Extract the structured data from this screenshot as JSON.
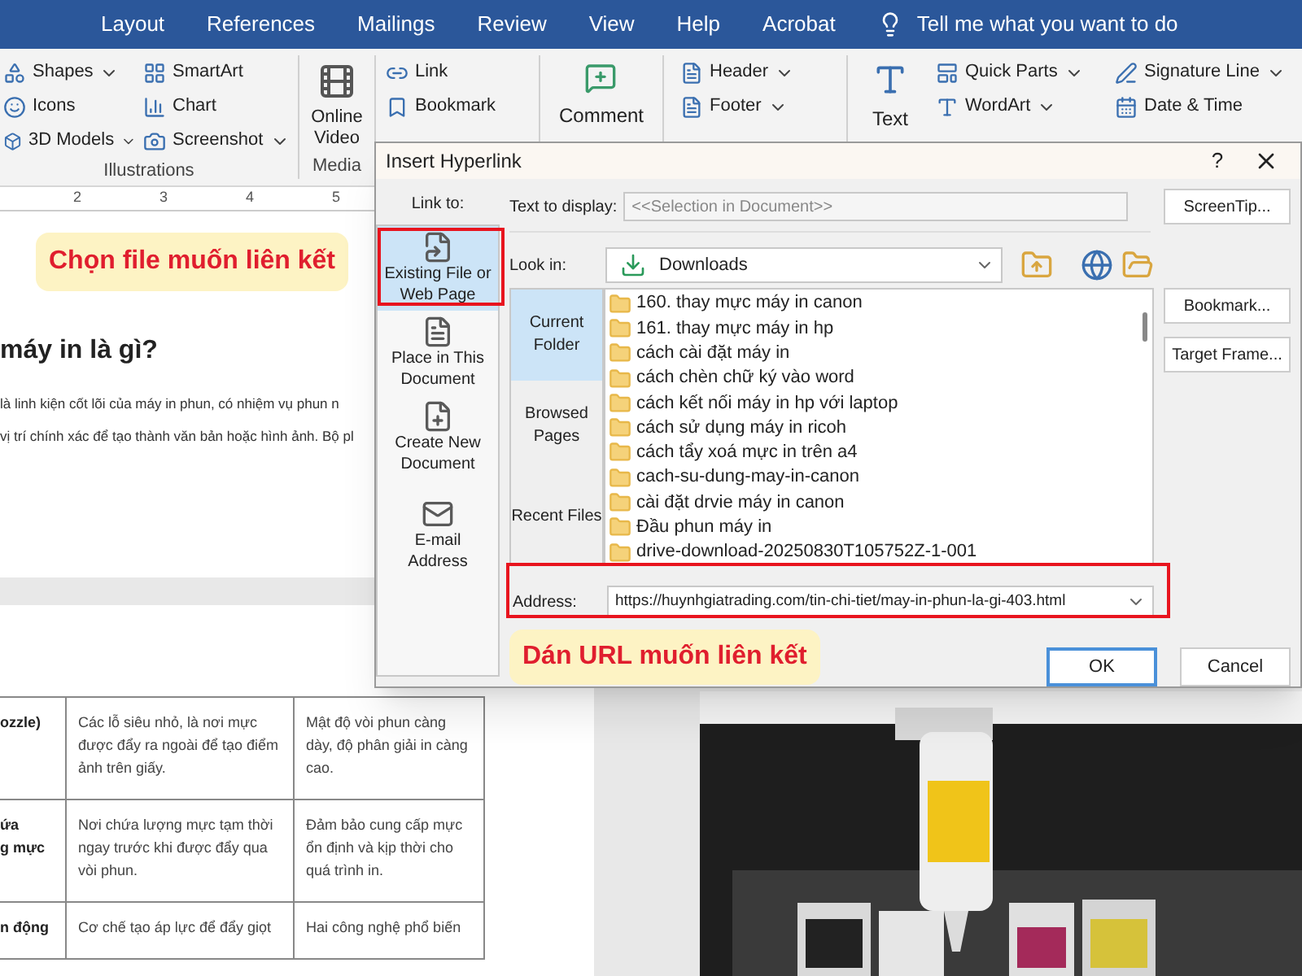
{
  "menu_tabs": [
    "Layout",
    "References",
    "Mailings",
    "Review",
    "View",
    "Help",
    "Acrobat"
  ],
  "tell_me": "Tell me what you want to do",
  "ribbon": {
    "illustrations": {
      "col1": [
        {
          "label": "Shapes",
          "dropdown": true
        },
        {
          "label": "Icons",
          "dropdown": false
        },
        {
          "label": "3D Models",
          "dropdown": true
        }
      ],
      "col2": [
        {
          "label": "SmartArt",
          "dropdown": false
        },
        {
          "label": "Chart",
          "dropdown": false
        },
        {
          "label": "Screenshot",
          "dropdown": true
        }
      ],
      "group_label": "Illustrations"
    },
    "media": {
      "button": "Online Video",
      "group_label": "Media"
    },
    "links": [
      {
        "label": "Link"
      },
      {
        "label": "Bookmark"
      }
    ],
    "comment": "Comment",
    "header_footer": [
      {
        "label": "Header"
      },
      {
        "label": "Footer"
      }
    ],
    "text": {
      "button": "Text",
      "col1": [
        {
          "label": "Quick Parts"
        },
        {
          "label": "WordArt"
        }
      ],
      "col2": [
        {
          "label": "Signature Line",
          "dropdown": true
        },
        {
          "label": "Date & Time",
          "dropdown": false
        }
      ]
    }
  },
  "ruler": [
    "2",
    "3",
    "4",
    "5"
  ],
  "document": {
    "heading": "máy in là gì?",
    "paragraphs": [
      "là linh kiện cốt lõi của máy in phun, có nhiệm vụ phun n",
      "vị trí chính xác để tạo thành văn bản hoặc hình ảnh. Bộ pl"
    ],
    "table": {
      "rows": [
        [
          "ozzle)",
          "Các lỗ siêu nhỏ, là nơi mực được đẩy ra ngoài để tạo điểm ảnh trên giấy.",
          "Mật độ vòi phun càng dày, độ phân giải in càng cao."
        ],
        [
          "ứa\ng mực",
          "Nơi chứa lượng mực tạm thời ngay trước khi được đẩy qua vòi phun.",
          "Đảm bảo cung cấp mực ổn định và kịp thời cho quá trình in."
        ],
        [
          "n động",
          "Cơ chế tạo áp lực để đẩy giọt",
          "Hai công nghệ phổ biến"
        ]
      ]
    }
  },
  "callouts": [
    "Chọn file muốn liên kết",
    "Dán URL muốn liên kết"
  ],
  "dialog": {
    "title": "Insert Hyperlink",
    "help": "?",
    "link_to_label": "Link to:",
    "link_to": [
      {
        "label": "Existing File or Web Page",
        "kind": "file",
        "selected": true
      },
      {
        "label": "Place in This Document",
        "kind": "place",
        "selected": false
      },
      {
        "label": "Create New Document",
        "kind": "new",
        "selected": false
      },
      {
        "label": "E-mail Address",
        "kind": "mail",
        "selected": false
      }
    ],
    "text_to_display": {
      "label": "Text to display:",
      "placeholder": "<<Selection in Document>>"
    },
    "look_in": {
      "label": "Look in:",
      "value": "Downloads"
    },
    "nav": [
      {
        "label": "Current Folder",
        "selected": true
      },
      {
        "label": "Browsed Pages",
        "selected": false
      },
      {
        "label": "Recent Files",
        "selected": false
      }
    ],
    "files": [
      "160. thay mực máy in canon",
      "161. thay mực máy in hp",
      "cách cài đặt máy in",
      "cách chèn chữ ký vào word",
      "cách kết nối máy in hp với laptop",
      "cách sử dụng máy in ricoh",
      "cách tẩy xoá mực in trên a4",
      "cach-su-dung-may-in-canon",
      "cài đặt drvie máy in canon",
      "Đầu phun máy in",
      "drive-download-20250830T105752Z-1-001"
    ],
    "address": {
      "label": "Address:",
      "value": "https://huynhgiatrading.com/tin-chi-tiet/may-in-phun-la-gi-403.html"
    },
    "side_buttons": [
      "ScreenTip...",
      "Bookmark...",
      "Target Frame..."
    ],
    "buttons": [
      {
        "label": "OK",
        "default": true
      },
      {
        "label": "Cancel",
        "default": false
      }
    ]
  },
  "photo": {
    "kind": "picture"
  }
}
